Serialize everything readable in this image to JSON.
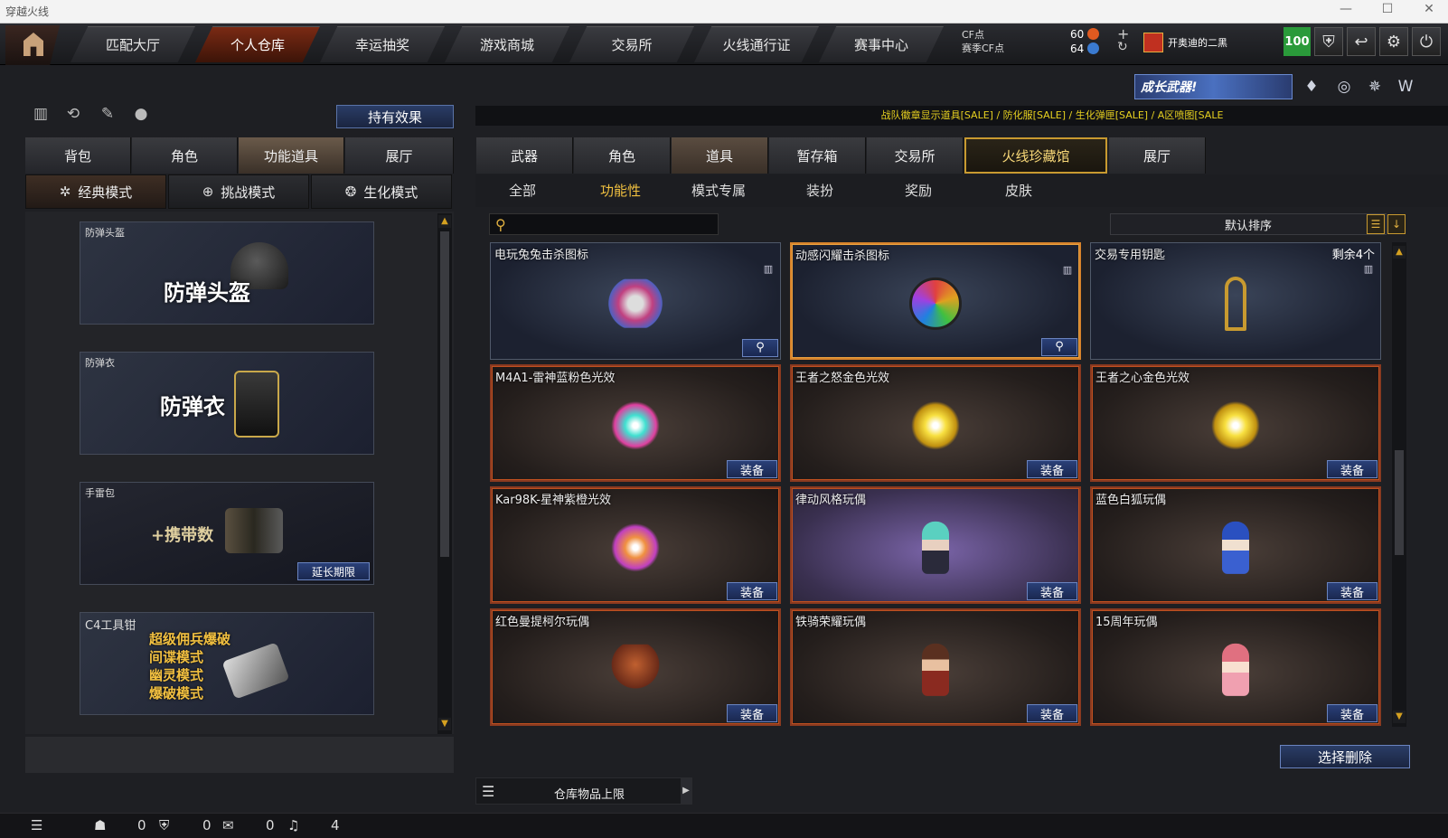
{
  "window": {
    "title": "穿越火线"
  },
  "nav": {
    "tabs": [
      "匹配大厅",
      "个人仓库",
      "幸运抽奖",
      "游戏商城",
      "交易所",
      "火线通行证",
      "赛事中心"
    ],
    "active": "个人仓库"
  },
  "currency": {
    "cf_label": "CF点",
    "season_label": "赛季CF点",
    "cf_value": "60",
    "season_value": "64"
  },
  "user": {
    "name": "开奥迪的二黑",
    "level": "100"
  },
  "left": {
    "hold_effects": "持有效果",
    "tabs": [
      "背包",
      "角色",
      "功能道具",
      "展厅"
    ],
    "active_tab": "功能道具",
    "modes": [
      "经典模式",
      "挑战模式",
      "生化模式"
    ],
    "active_mode": "经典模式",
    "items": [
      {
        "caption": "防弹头盔",
        "big": "防弹头盔"
      },
      {
        "caption": "防弹衣",
        "big": "防弹衣"
      },
      {
        "caption": "手雷包",
        "big": "+携带数",
        "button": "延长期限"
      },
      {
        "caption": "C4工具钳",
        "lines": [
          "超级佣兵爆破",
          "间谍模式",
          "幽灵模式",
          "爆破模式"
        ]
      }
    ]
  },
  "right": {
    "banner": "成长武器!",
    "marquee": "战队徽章显示道具[SALE] / 防化服[SALE] / 生化弹匣[SALE] / A区喷图[SALE",
    "tabs": [
      "武器",
      "角色",
      "道具",
      "暂存箱",
      "交易所",
      "火线珍藏馆",
      "展厅"
    ],
    "active_tab": "道具",
    "subtabs": [
      "全部",
      "功能性",
      "模式专属",
      "装扮",
      "奖励",
      "皮肤"
    ],
    "active_subtab": "功能性",
    "search": {
      "placeholder": "",
      "value": ""
    },
    "sort_label": "默认排序",
    "equip_label": "装备",
    "remaining": "剩余4个",
    "items": [
      {
        "name": "电玩兔兔击杀图标",
        "kind": "icon-skull"
      },
      {
        "name": "动感闪耀击杀图标",
        "kind": "icon-star"
      },
      {
        "name": "交易专用钥匙",
        "kind": "key"
      },
      {
        "name": "M4A1-雷神蓝粉色光效",
        "kind": "orb-cyan"
      },
      {
        "name": "王者之怒金色光效",
        "kind": "orb-gold"
      },
      {
        "name": "王者之心金色光效",
        "kind": "orb-gold"
      },
      {
        "name": "Kar98K-星神紫橙光效",
        "kind": "orb-pink"
      },
      {
        "name": "律动风格玩偶",
        "kind": "doll"
      },
      {
        "name": "蓝色白狐玩偶",
        "kind": "doll"
      },
      {
        "name": "红色曼提柯尔玩偶",
        "kind": "doll"
      },
      {
        "name": "铁骑荣耀玩偶",
        "kind": "doll"
      },
      {
        "name": "15周年玩偶",
        "kind": "doll"
      }
    ],
    "delete_selected": "选择删除",
    "capacity": "仓库物品上限"
  },
  "status": {
    "friends": "0",
    "guild": "0",
    "chat": "0",
    "voice": "4"
  },
  "colors": {
    "accent": "#d8842c",
    "active_subtab": "#f0c040",
    "marquee": "#e6d020",
    "level": "#2a9a3a"
  }
}
